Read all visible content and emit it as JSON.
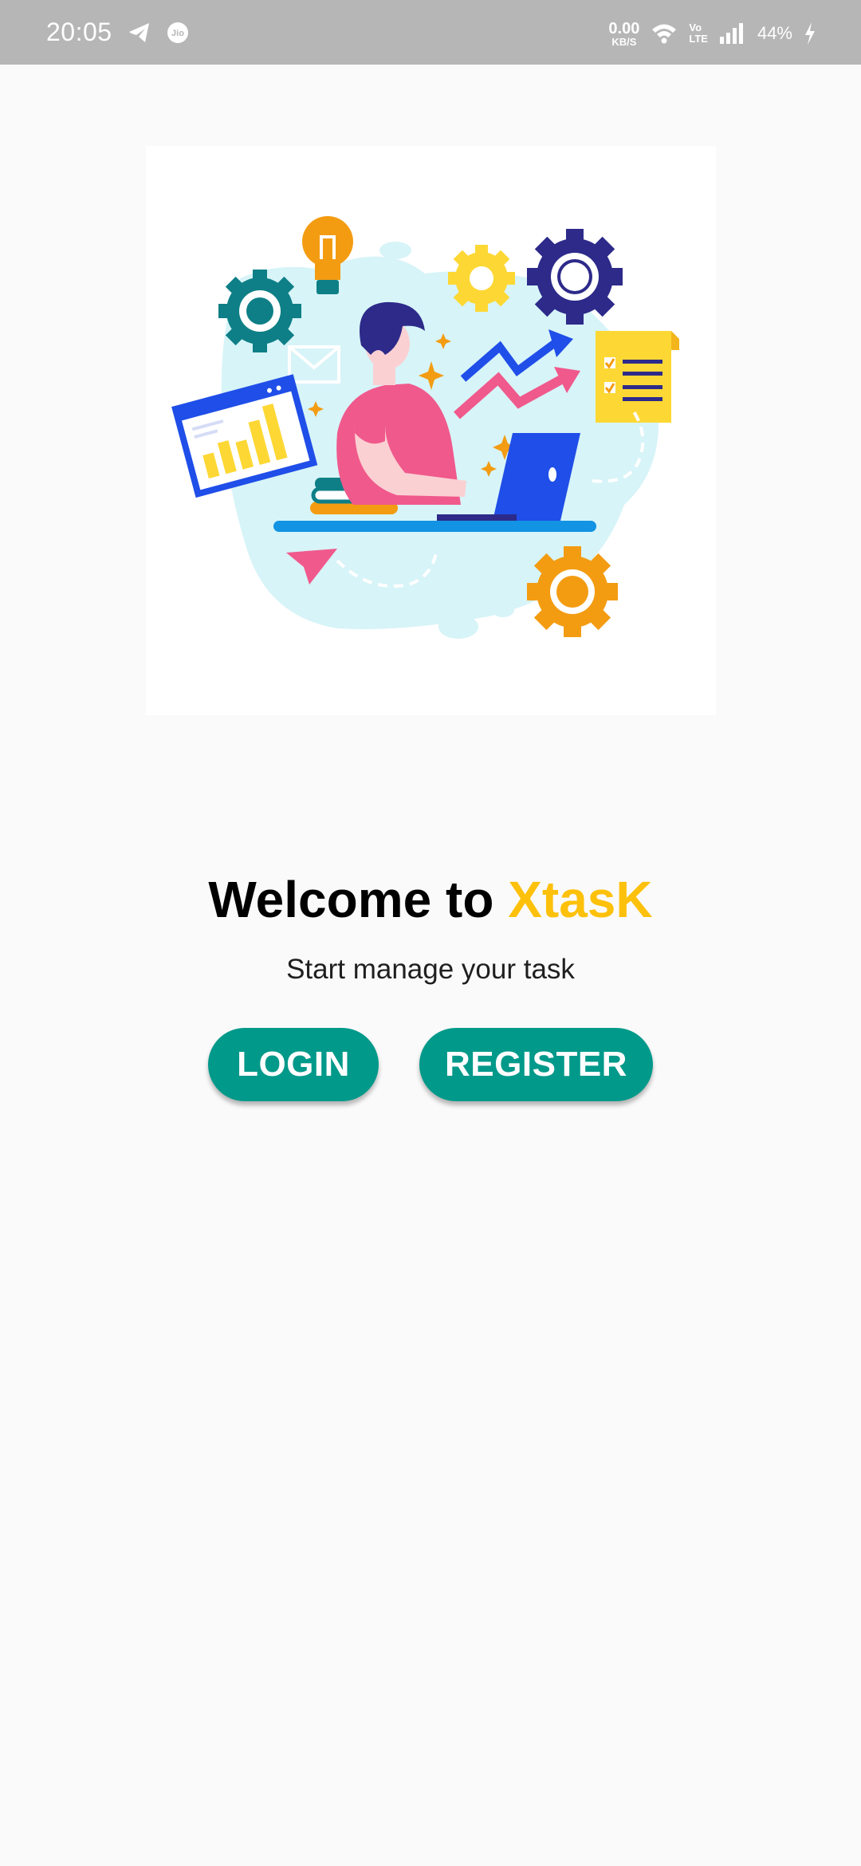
{
  "status_bar": {
    "time": "20:05",
    "left_icons": [
      "telegram-icon",
      "jio-icon"
    ],
    "net_speed_value": "0.00",
    "net_speed_unit": "KB/S",
    "volte_top": "Vo",
    "volte_bottom": "LTE",
    "battery": "44%",
    "right_icons": [
      "wifi-icon",
      "signal-icon",
      "charging-icon"
    ]
  },
  "illustration": {
    "subject": "person-working-at-laptop-illustration"
  },
  "welcome": {
    "prefix": "Welcome to",
    "brand": "XtasK",
    "brand_color": "#fdc10b"
  },
  "subtitle": "Start manage your task",
  "actions": {
    "login_label": "LOGIN",
    "register_label": "REGISTER",
    "button_color": "#00998a"
  }
}
